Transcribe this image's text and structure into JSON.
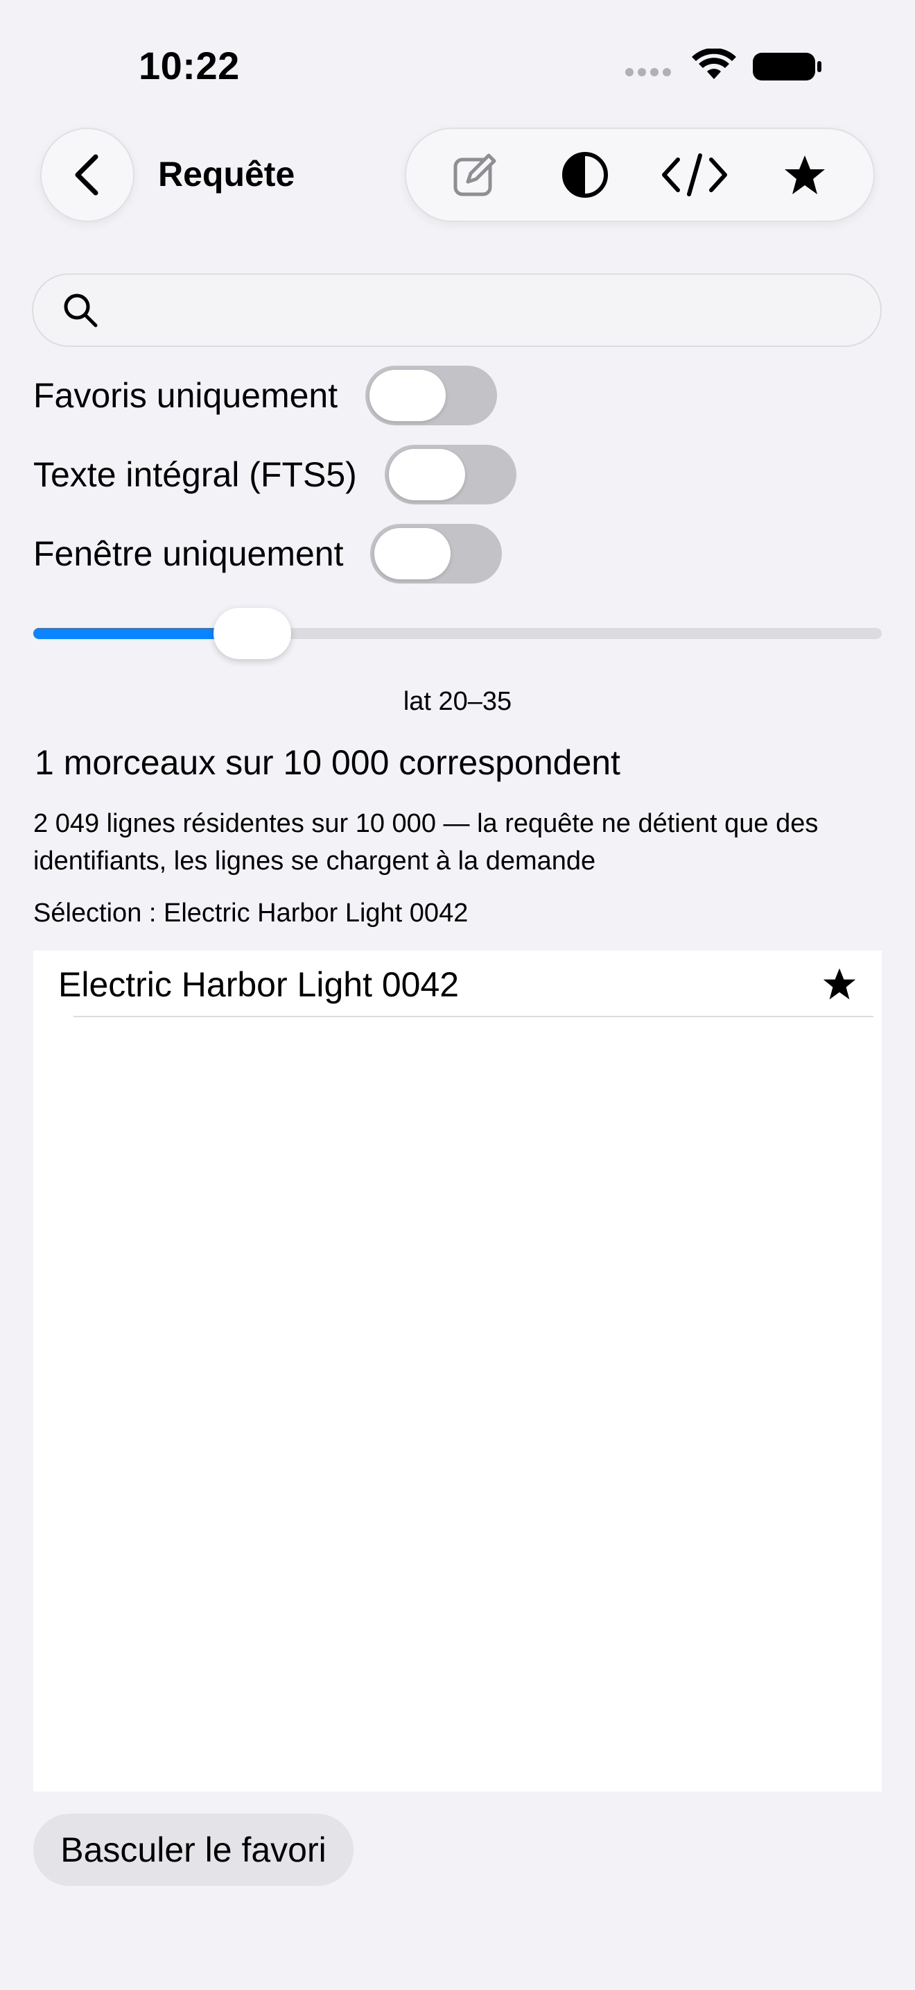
{
  "status_bar": {
    "time": "10:22"
  },
  "nav": {
    "title": "Requête",
    "toolbar_icons": [
      "edit-icon",
      "contrast-icon",
      "code-icon",
      "star-icon"
    ]
  },
  "search": {
    "value": "",
    "placeholder": ""
  },
  "filters": [
    {
      "label": "Favoris uniquement",
      "on": false
    },
    {
      "label": "Texte intégral (FTS5)",
      "on": false
    },
    {
      "label": "Fenêtre uniquement",
      "on": false
    }
  ],
  "slider": {
    "value_fraction": 0.24,
    "caption": "lat 20–35",
    "accent": "#0a84ff"
  },
  "summary": {
    "match_count": "1 morceaux sur 10 000 correspondent",
    "resident": "2 049 lignes résidentes sur 10 000 — la requête ne détient que des identifiants, les lignes se chargent à la demande",
    "selection": "Sélection : Electric Harbor Light 0042"
  },
  "results": [
    {
      "title": "Electric Harbor Light 0042",
      "favorite": true
    }
  ],
  "actions": {
    "toggle_favorite": "Basculer le favori"
  }
}
